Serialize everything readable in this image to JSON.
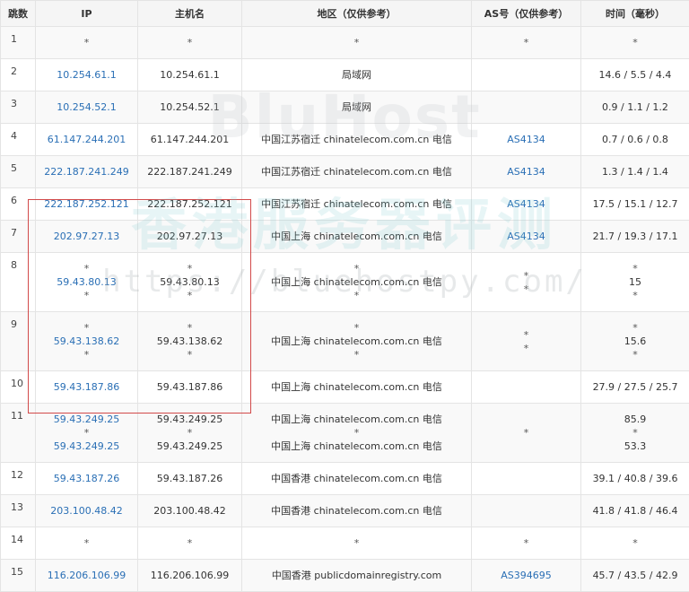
{
  "headers": [
    "跳数",
    "IP",
    "主机名",
    "地区（仅供参考）",
    "AS号（仅供参考）",
    "时间（毫秒）"
  ],
  "rows": [
    {
      "hop": "1",
      "ip": [
        "*"
      ],
      "host": [
        "*"
      ],
      "region": [
        "*"
      ],
      "as": [
        "*"
      ],
      "time": [
        "*"
      ]
    },
    {
      "hop": "2",
      "ip": [
        "10.254.61.1"
      ],
      "host": [
        "10.254.61.1"
      ],
      "region": [
        "局域网"
      ],
      "as": [
        ""
      ],
      "time": [
        "14.6 / 5.5 / 4.4"
      ]
    },
    {
      "hop": "3",
      "ip": [
        "10.254.52.1"
      ],
      "host": [
        "10.254.52.1"
      ],
      "region": [
        "局域网"
      ],
      "as": [
        ""
      ],
      "time": [
        "0.9 / 1.1 / 1.2"
      ]
    },
    {
      "hop": "4",
      "ip": [
        "61.147.244.201"
      ],
      "host": [
        "61.147.244.201"
      ],
      "region": [
        "中国江苏宿迁 chinatelecom.com.cn 电信"
      ],
      "as": [
        "AS4134"
      ],
      "time": [
        "0.7 / 0.6 / 0.8"
      ]
    },
    {
      "hop": "5",
      "ip": [
        "222.187.241.249"
      ],
      "host": [
        "222.187.241.249"
      ],
      "region": [
        "中国江苏宿迁 chinatelecom.com.cn 电信"
      ],
      "as": [
        "AS4134"
      ],
      "time": [
        "1.3 / 1.4 / 1.4"
      ]
    },
    {
      "hop": "6",
      "ip": [
        "222.187.252.121"
      ],
      "host": [
        "222.187.252.121"
      ],
      "region": [
        "中国江苏宿迁 chinatelecom.com.cn 电信"
      ],
      "as": [
        "AS4134"
      ],
      "time": [
        "17.5 / 15.1 / 12.7"
      ]
    },
    {
      "hop": "7",
      "ip": [
        "202.97.27.13"
      ],
      "host": [
        "202.97.27.13"
      ],
      "region": [
        "中国上海 chinatelecom.com.cn 电信"
      ],
      "as": [
        "AS4134"
      ],
      "time": [
        "21.7 / 19.3 / 17.1"
      ]
    },
    {
      "hop": "8",
      "ip": [
        "*",
        "59.43.80.13",
        "*"
      ],
      "host": [
        "*",
        "59.43.80.13",
        "*"
      ],
      "region": [
        "*",
        "中国上海 chinatelecom.com.cn 电信",
        "*"
      ],
      "as": [
        "*",
        "",
        "*"
      ],
      "time": [
        "*",
        "15",
        "*"
      ]
    },
    {
      "hop": "9",
      "ip": [
        "*",
        "59.43.138.62",
        "*"
      ],
      "host": [
        "*",
        "59.43.138.62",
        "*"
      ],
      "region": [
        "*",
        "中国上海 chinatelecom.com.cn 电信",
        "*"
      ],
      "as": [
        "*",
        "",
        "*"
      ],
      "time": [
        "*",
        "15.6",
        "*"
      ]
    },
    {
      "hop": "10",
      "ip": [
        "59.43.187.86"
      ],
      "host": [
        "59.43.187.86"
      ],
      "region": [
        "中国上海 chinatelecom.com.cn 电信"
      ],
      "as": [
        ""
      ],
      "time": [
        "27.9 / 27.5 / 25.7"
      ]
    },
    {
      "hop": "11",
      "ip": [
        "59.43.249.25",
        "*",
        "59.43.249.25"
      ],
      "host": [
        "59.43.249.25",
        "*",
        "59.43.249.25"
      ],
      "region": [
        "中国上海 chinatelecom.com.cn 电信",
        "*",
        "中国上海 chinatelecom.com.cn 电信"
      ],
      "as": [
        "",
        "*",
        ""
      ],
      "time": [
        "85.9",
        "*",
        "53.3"
      ]
    },
    {
      "hop": "12",
      "ip": [
        "59.43.187.26"
      ],
      "host": [
        "59.43.187.26"
      ],
      "region": [
        "中国香港 chinatelecom.com.cn 电信"
      ],
      "as": [
        ""
      ],
      "time": [
        "39.1 / 40.8 / 39.6"
      ]
    },
    {
      "hop": "13",
      "ip": [
        "203.100.48.42"
      ],
      "host": [
        "203.100.48.42"
      ],
      "region": [
        "中国香港 chinatelecom.com.cn 电信"
      ],
      "as": [
        ""
      ],
      "time": [
        "41.8 / 41.8 / 46.4"
      ]
    },
    {
      "hop": "14",
      "ip": [
        "*"
      ],
      "host": [
        "*"
      ],
      "region": [
        "*"
      ],
      "as": [
        "*"
      ],
      "time": [
        "*"
      ]
    },
    {
      "hop": "15",
      "ip": [
        "116.206.106.99"
      ],
      "host": [
        "116.206.106.99"
      ],
      "region": [
        "中国香港 publicdomainregistry.com"
      ],
      "as": [
        "AS394695"
      ],
      "time": [
        "45.7 / 43.5 / 42.9"
      ]
    }
  ],
  "watermark": {
    "brand": "BluHost",
    "cn": "香港服务器评测",
    "url": "https://bluehostpy.com/"
  },
  "colors": {
    "link": "#2a6fb5",
    "highlight_box": "#d24a4a",
    "header_bg": "#f5f5f5",
    "border": "#e4e4e4"
  }
}
